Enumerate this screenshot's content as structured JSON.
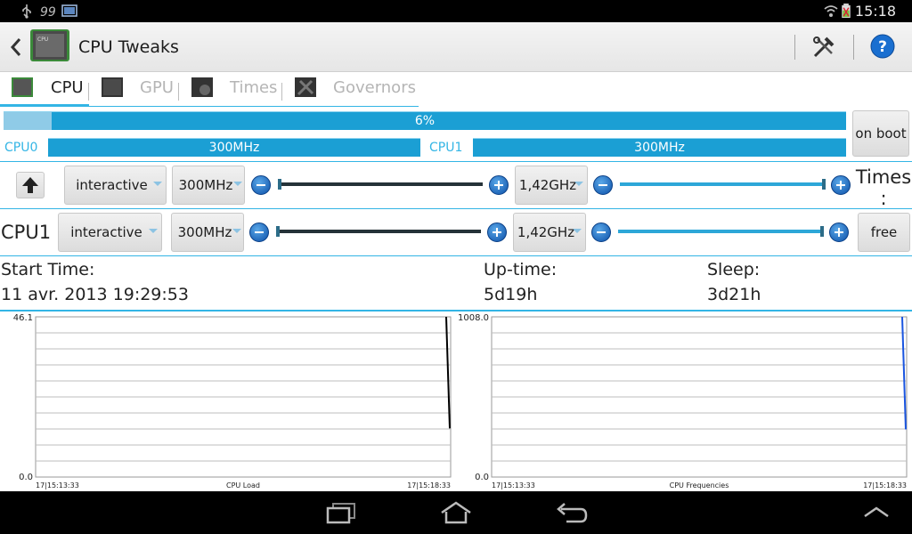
{
  "status_bar": {
    "time": "15:18",
    "left_icons": [
      "usb-icon",
      "sync-icon",
      "screenshot-icon"
    ],
    "right_icons": [
      "wifi-icon",
      "battery-charging-icon"
    ]
  },
  "action_bar": {
    "title": "CPU Tweaks",
    "icons": [
      "back-icon",
      "cpu-chip-icon",
      "tools-icon",
      "help-icon"
    ]
  },
  "tabs": [
    {
      "label": "CPU",
      "icon": "cpu-chip-icon",
      "active": true
    },
    {
      "label": "GPU",
      "icon": "gpu-chip-icon",
      "active": false
    },
    {
      "label": "Times",
      "icon": "clock-chip-icon",
      "active": false
    },
    {
      "label": "Governors",
      "icon": "wrench-chip-icon",
      "active": false
    }
  ],
  "load": {
    "label": "6%",
    "fraction": 0.06,
    "on_boot_label": "on boot"
  },
  "cpu0": {
    "label": "CPU0",
    "freq": "300MHz"
  },
  "cpu1": {
    "label": "CPU1",
    "freq": "300MHz"
  },
  "row1": {
    "governor": "interactive",
    "min_freq": "300MHz",
    "max_freq": "1,42GHz",
    "side_label": "Times\n:"
  },
  "row2": {
    "label": "CPU1",
    "governor": "interactive",
    "min_freq": "300MHz",
    "max_freq": "1,42GHz",
    "button": "free"
  },
  "info": {
    "start_time_label": "Start Time:",
    "start_time_value": "11 avr. 2013 19:29:53",
    "uptime_label": "Up-time:",
    "uptime_value": "5d19h",
    "sleep_label": "Sleep:",
    "sleep_value": "3d21h"
  },
  "chart_data": [
    {
      "type": "line",
      "title": "CPU Load",
      "ylim": [
        0.0,
        46.1
      ],
      "y_ticks": [
        "46.1",
        "0.0"
      ],
      "x_ticks": [
        "17|15:13:33",
        "17|15:18:33"
      ],
      "grid": true,
      "color": "#000000",
      "series": [
        {
          "x": [
            "17|15:13:33",
            "17|15:18:28",
            "17|15:18:33"
          ],
          "values": [
            null,
            46.1,
            14.0
          ]
        }
      ]
    },
    {
      "type": "line",
      "title": "CPU Frequencies",
      "ylim": [
        0.0,
        1008.0
      ],
      "y_ticks": [
        "1008.0",
        "0.0"
      ],
      "x_ticks": [
        "17|15:13:33",
        "17|15:18:33"
      ],
      "grid": true,
      "color": "#1a55e0",
      "series": [
        {
          "x": [
            "17|15:13:33",
            "17|15:18:28",
            "17|15:18:33"
          ],
          "values": [
            null,
            1008.0,
            300.0
          ]
        }
      ]
    }
  ],
  "nav_bar": {
    "icons": [
      "recent-apps-icon",
      "home-icon",
      "back-icon",
      "menu-up-icon"
    ]
  }
}
